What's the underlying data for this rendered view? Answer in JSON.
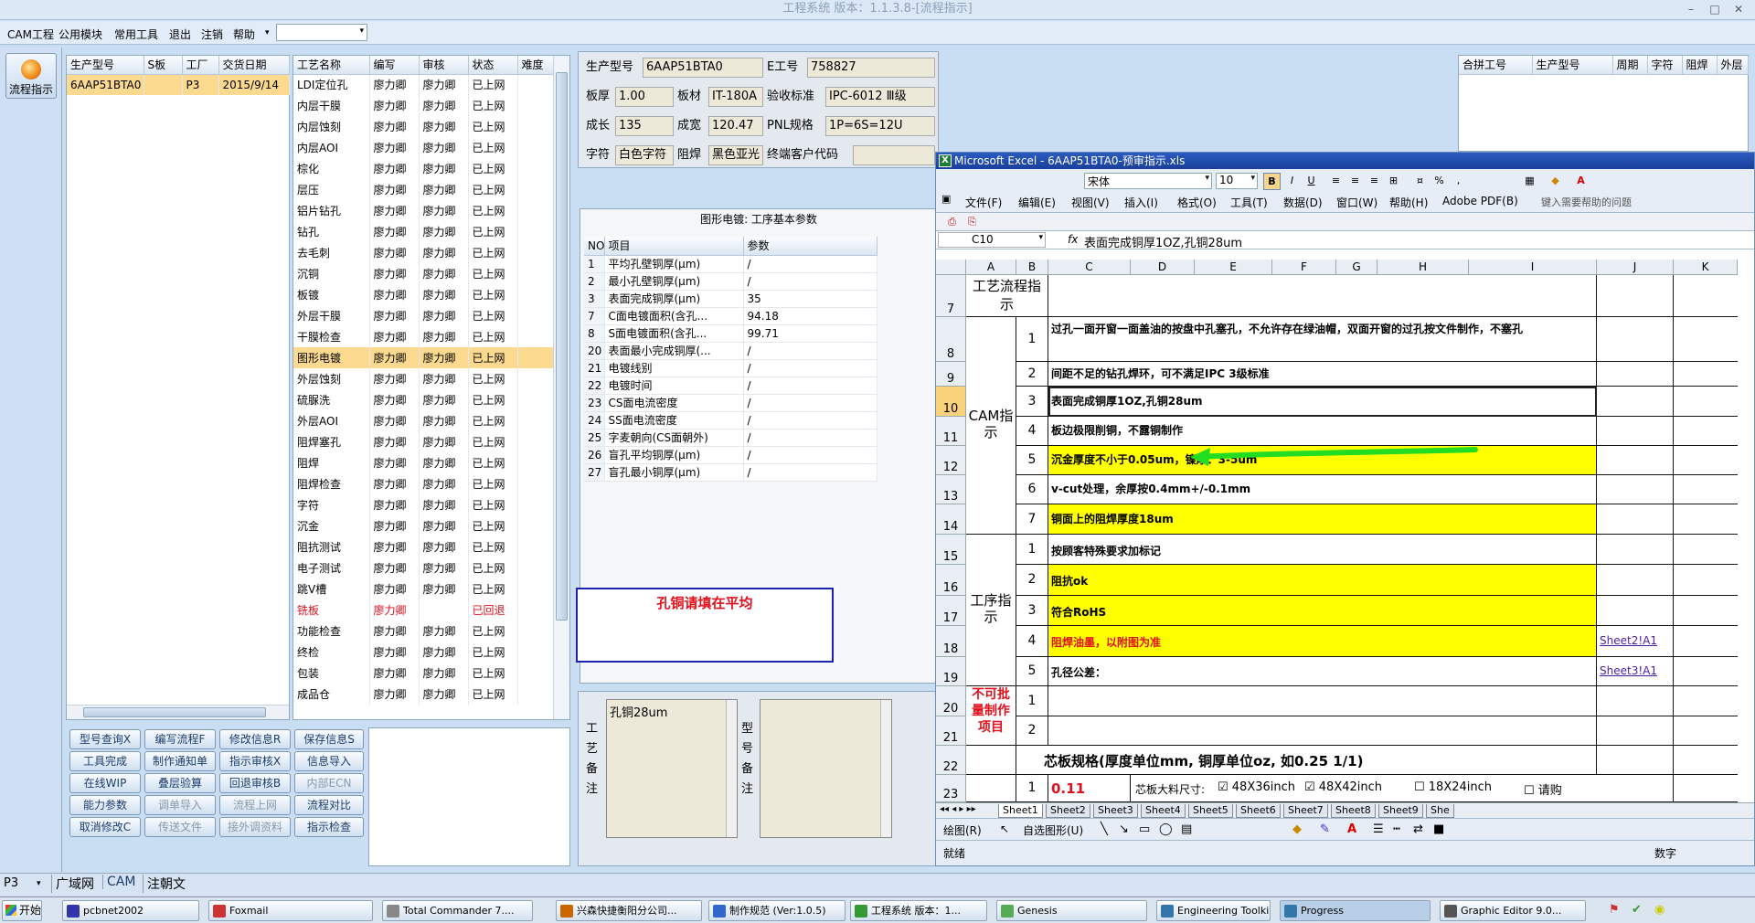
{
  "window": {
    "title": "工程系统 版本：1.1.3.8-[流程指示]"
  },
  "menu": {
    "items": [
      "CAM工程",
      "公用模块",
      "常用工具",
      "退出",
      "注销",
      "帮助"
    ]
  },
  "left_strip": {
    "flow_button": "流程指示"
  },
  "model_table": {
    "headers": [
      "生产型号",
      "S板",
      "工厂",
      "交货日期"
    ],
    "rows": [
      [
        "6AAP51BTA0",
        "",
        "P3",
        "2015/9/14"
      ]
    ]
  },
  "process_table": {
    "headers": [
      "工艺名称",
      "编写",
      "审核",
      "状态",
      "难度"
    ],
    "rows": [
      {
        "name": "LDI定位孔",
        "writer": "廖力卿",
        "reviewer": "廖力卿",
        "status": "已上网"
      },
      {
        "name": "内层干膜",
        "writer": "廖力卿",
        "reviewer": "廖力卿",
        "status": "已上网"
      },
      {
        "name": "内层蚀刻",
        "writer": "廖力卿",
        "reviewer": "廖力卿",
        "status": "已上网"
      },
      {
        "name": "内层AOI",
        "writer": "廖力卿",
        "reviewer": "廖力卿",
        "status": "已上网"
      },
      {
        "name": "棕化",
        "writer": "廖力卿",
        "reviewer": "廖力卿",
        "status": "已上网"
      },
      {
        "name": "层压",
        "writer": "廖力卿",
        "reviewer": "廖力卿",
        "status": "已上网"
      },
      {
        "name": "铝片钻孔",
        "writer": "廖力卿",
        "reviewer": "廖力卿",
        "status": "已上网"
      },
      {
        "name": "钻孔",
        "writer": "廖力卿",
        "reviewer": "廖力卿",
        "status": "已上网"
      },
      {
        "name": "去毛刺",
        "writer": "廖力卿",
        "reviewer": "廖力卿",
        "status": "已上网"
      },
      {
        "name": "沉铜",
        "writer": "廖力卿",
        "reviewer": "廖力卿",
        "status": "已上网"
      },
      {
        "name": "板镀",
        "writer": "廖力卿",
        "reviewer": "廖力卿",
        "status": "已上网"
      },
      {
        "name": "外层干膜",
        "writer": "廖力卿",
        "reviewer": "廖力卿",
        "status": "已上网"
      },
      {
        "name": "干膜检查",
        "writer": "廖力卿",
        "reviewer": "廖力卿",
        "status": "已上网"
      },
      {
        "name": "图形电镀",
        "writer": "廖力卿",
        "reviewer": "廖力卿",
        "status": "已上网"
      },
      {
        "name": "外层蚀刻",
        "writer": "廖力卿",
        "reviewer": "廖力卿",
        "status": "已上网"
      },
      {
        "name": "硫脲洗",
        "writer": "廖力卿",
        "reviewer": "廖力卿",
        "status": "已上网"
      },
      {
        "name": "外层AOI",
        "writer": "廖力卿",
        "reviewer": "廖力卿",
        "status": "已上网"
      },
      {
        "name": "阻焊塞孔",
        "writer": "廖力卿",
        "reviewer": "廖力卿",
        "status": "已上网"
      },
      {
        "name": "阻焊",
        "writer": "廖力卿",
        "reviewer": "廖力卿",
        "status": "已上网"
      },
      {
        "name": "阻焊检查",
        "writer": "廖力卿",
        "reviewer": "廖力卿",
        "status": "已上网"
      },
      {
        "name": "字符",
        "writer": "廖力卿",
        "reviewer": "廖力卿",
        "status": "已上网"
      },
      {
        "name": "沉金",
        "writer": "廖力卿",
        "reviewer": "廖力卿",
        "status": "已上网"
      },
      {
        "name": "阻抗测试",
        "writer": "廖力卿",
        "reviewer": "廖力卿",
        "status": "已上网"
      },
      {
        "name": "电子测试",
        "writer": "廖力卿",
        "reviewer": "廖力卿",
        "status": "已上网"
      },
      {
        "name": "跳V槽",
        "writer": "廖力卿",
        "reviewer": "廖力卿",
        "status": "已上网"
      },
      {
        "name": "铣板",
        "writer": "廖力卿",
        "reviewer": "",
        "status": "已回退"
      },
      {
        "name": "功能检查",
        "writer": "廖力卿",
        "reviewer": "廖力卿",
        "status": "已上网"
      },
      {
        "name": "终检",
        "writer": "廖力卿",
        "reviewer": "廖力卿",
        "status": "已上网"
      },
      {
        "name": "包装",
        "writer": "廖力卿",
        "reviewer": "廖力卿",
        "status": "已上网"
      },
      {
        "name": "成品仓",
        "writer": "廖力卿",
        "reviewer": "廖力卿",
        "status": "已上网"
      }
    ]
  },
  "buttons": [
    [
      "型号查询X",
      "编写流程F",
      "修改信息R",
      "保存信息S"
    ],
    [
      "工具完成",
      "制作通知单",
      "指示审核X",
      "信息导入"
    ],
    [
      "在线WIP",
      "叠层验算",
      "回退审核B",
      "内部ECN"
    ],
    [
      "能力参数",
      "调单导入",
      "流程上网",
      "流程对比"
    ],
    [
      "取消修改C",
      "传送文件",
      "接外调资料",
      "指示检查"
    ]
  ],
  "info": {
    "model_label": "生产型号",
    "model": "6AAP51BTA0",
    "e_label": "E工号",
    "e_no": "758827",
    "thick_label": "板厚",
    "thick": "1.00",
    "mat_label": "板材",
    "mat": "IT-180A",
    "std_label": "验收标准",
    "std": "IPC-6012 Ⅲ级",
    "len_label": "成长",
    "len": "135",
    "wid_label": "成宽",
    "wid": "120.47",
    "pnl_label": "PNL规格",
    "pnl": "1P=6S=12U",
    "char_label": "字符",
    "char": "白色字符",
    "mask_label": "阻焊",
    "mask": "黑色亚光",
    "cust_label": "终端客户代码",
    "cust": ""
  },
  "params": {
    "title": "图形电镀: 工序基本参数",
    "headers": [
      "NO",
      "项目",
      "参数"
    ],
    "rows": [
      [
        "1",
        "平均孔壁铜厚(μm)",
        "/"
      ],
      [
        "2",
        "最小孔壁铜厚(μm)",
        "/"
      ],
      [
        "3",
        "表面完成铜厚(μm)",
        "35"
      ],
      [
        "7",
        "C面电镀面积(含孔...",
        "94.18"
      ],
      [
        "8",
        "S面电镀面积(含孔...",
        "99.71"
      ],
      [
        "20",
        "表面最小完成铜厚(...",
        "/"
      ],
      [
        "21",
        "电镀线别",
        "/"
      ],
      [
        "22",
        "电镀时间",
        "/"
      ],
      [
        "23",
        "CS面电流密度",
        "/"
      ],
      [
        "24",
        "SS面电流密度",
        "/"
      ],
      [
        "25",
        "字麦朝向(CS面朝外)",
        "/"
      ],
      [
        "26",
        "盲孔平均铜厚(μm)",
        "/"
      ],
      [
        "27",
        "盲孔最小铜厚(μm)",
        "/"
      ]
    ]
  },
  "note_box": "孔铜请填在平均",
  "remarks": {
    "craft_label": "工艺备注",
    "craft_text": "孔铜28um",
    "model_label": "型号备注",
    "model_text": ""
  },
  "merge_table": {
    "headers": [
      "合拼工号",
      "生产型号",
      "周期",
      "字符",
      "阻焊",
      "外层"
    ]
  },
  "excel": {
    "title": "Microsoft Excel - 6AAP51BTA0-预审指示.xls",
    "font": "宋体",
    "size": "10",
    "menus": [
      "文件(F)",
      "编辑(E)",
      "视图(V)",
      "插入(I)",
      "格式(O)",
      "工具(T)",
      "数据(D)",
      "窗口(W)",
      "帮助(H)",
      "Adobe PDF(B)"
    ],
    "help_box": "键入需要帮助的问题",
    "name_box": "C10",
    "formula": "表面完成铜厚1OZ,孔铜28um",
    "cols": [
      "A",
      "B",
      "C",
      "D",
      "E",
      "F",
      "G",
      "H",
      "I",
      "J",
      "K"
    ],
    "rows": [
      "7",
      "8",
      "9",
      "10",
      "11",
      "12",
      "13",
      "14",
      "15",
      "16",
      "17",
      "18",
      "19",
      "20",
      "21",
      "22",
      "23"
    ],
    "sections": {
      "flow": "工艺流程指示",
      "cam": "CAM指示",
      "proc": "工序指示",
      "nobatch": "不可批量制作项目"
    },
    "cam_items": [
      "过孔一面开窗一面盖油的按盘中孔塞孔，不允许存在绿油帽，双面开窗的过孔按文件制作，不塞孔",
      "间距不足的钻孔焊环，可不满足IPC 3级标准",
      "表面完成铜厚1OZ,孔铜28um",
      "板边极限削铜，不露铜制作",
      "沉金厚度不小于0.05um，镍厚：3-5um",
      "v-cut处理，余厚按0.4mm+/-0.1mm",
      "铜面上的阻焊厚度18um"
    ],
    "proc_items": [
      "按顾客特殊要求加标记",
      "阻抗ok",
      "符合RoHS",
      "阻焊油墨，以附图为准",
      "孔径公差："
    ],
    "proc_links": {
      "4": "Sheet2!A1",
      "5": "Sheet3!A1"
    },
    "nums": [
      "1",
      "2",
      "3",
      "4",
      "5",
      "6",
      "7"
    ],
    "core_title": "芯板规格(厚度单位mm, 铜厚单位oz, 如0.25 1/1)",
    "core_val": "0.11",
    "core_size_label": "芯板大料尺寸:",
    "opt1": "48X36inch",
    "opt2": "48X42inch",
    "opt3": "18X24inch",
    "opt4": "请购",
    "sheets": [
      "Sheet1",
      "Sheet2",
      "Sheet3",
      "Sheet4",
      "Sheet5",
      "Sheet6",
      "Sheet7",
      "Sheet8",
      "Sheet9",
      "She"
    ],
    "draw_label": "绘图(R)",
    "autoshape": "自选图形(U)",
    "status_left": "就绪",
    "status_right": "数字"
  },
  "statusbar": {
    "factory": "P3",
    "tabs": [
      "广域网",
      "CAM",
      "注朝文"
    ]
  },
  "taskbar": {
    "start": "开始",
    "items": [
      "pcbnet2002",
      "Foxmail",
      "Total Commander 7....",
      "兴森快捷衡阳分公司...",
      "制作规范 (Ver:1.0.5)",
      "工程系统  版本：1...",
      "Genesis",
      "Engineering Toolki...",
      "Progress",
      "Graphic Editor 9.0..."
    ]
  },
  "colors": {
    "accent": "#fbd98f",
    "yellow": "#ffff00",
    "red": "#e0101c",
    "arrow": "#22dd22"
  }
}
